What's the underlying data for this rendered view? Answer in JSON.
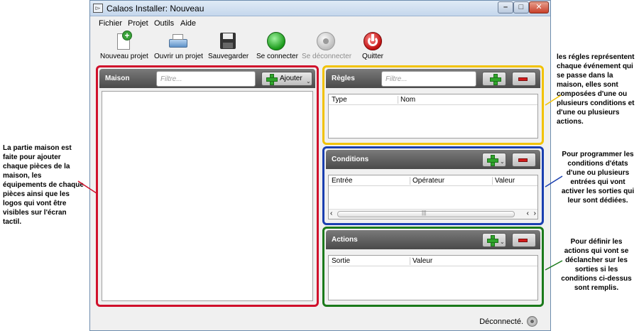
{
  "window": {
    "title": "Calaos Installer: Nouveau"
  },
  "menu": [
    "Fichier",
    "Projet",
    "Outils",
    "Aide"
  ],
  "toolbar": {
    "new_label": "Nouveau projet",
    "open_label": "Ouvrir un projet",
    "save_label": "Sauvegarder",
    "connect_label": "Se connecter",
    "disconnect_label": "Se déconnecter",
    "quit_label": "Quitter"
  },
  "maison": {
    "title": "Maison",
    "filter_placeholder": "Filtre...",
    "add_label": "Ajouter"
  },
  "regles": {
    "title": "Règles",
    "filter_placeholder": "Filtre...",
    "columns": [
      "Type",
      "Nom"
    ]
  },
  "conditions": {
    "title": "Conditions",
    "columns": [
      "Entrée",
      "Opérateur",
      "Valeur"
    ]
  },
  "actions": {
    "title": "Actions",
    "columns": [
      "Sortie",
      "Valeur"
    ]
  },
  "status": {
    "text": "Déconnecté."
  },
  "annotations": {
    "maison": "La partie maison est faite pour ajouter chaque pièces de la maison, les équipements de chaque pièces ainsi que les logos qui vont être visibles sur l'écran tactil.",
    "regles": "les régles représentent chaque événement qui se passe dans la maison, elles sont composées d'une ou plusieurs conditions et d'une ou plusieurs actions.",
    "conditions": "Pour programmer les conditions d'états d'une ou plusieurs entrées qui vont activer les sorties qui leur sont dédiées.",
    "actions": "Pour définir les actions qui vont se déclancher sur les sorties si les conditions ci-dessus sont remplis."
  },
  "colors": {
    "maison_border": "#d0102b",
    "regles_border": "#f2c200",
    "conditions_border": "#1a3fb0",
    "actions_border": "#1b7a1b"
  }
}
